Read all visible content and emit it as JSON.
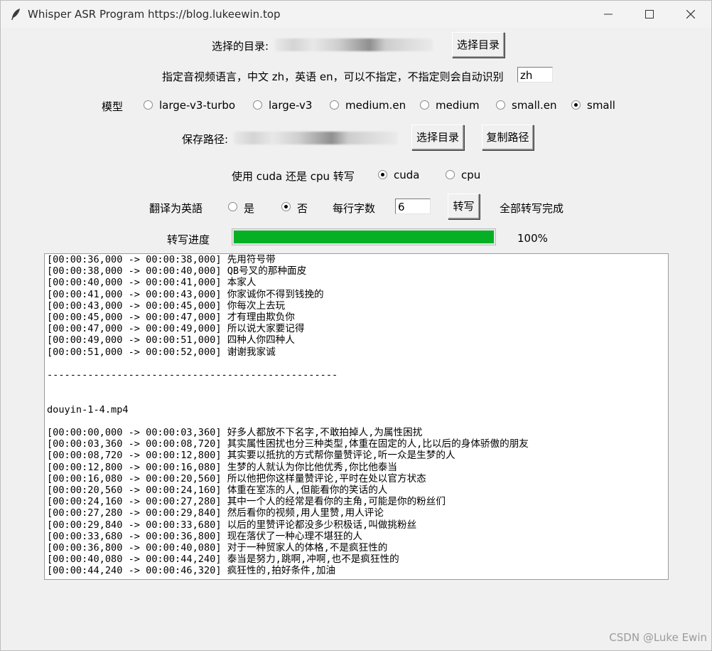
{
  "window": {
    "title": "Whisper ASR Program https://blog.lukeewin.top",
    "controls": [
      "minimize-icon",
      "maximize-icon",
      "close-icon"
    ]
  },
  "dir_row": {
    "label": "选择的目录:",
    "button": "选择目录"
  },
  "lang_row": {
    "label": "指定音视频语言，中文 zh，英语 en，可以不指定，不指定则会自动识别",
    "value": "zh"
  },
  "model_row": {
    "label": "模型",
    "options": [
      {
        "label": "large-v3-turbo",
        "selected": false
      },
      {
        "label": "large-v3",
        "selected": false
      },
      {
        "label": "medium.en",
        "selected": false
      },
      {
        "label": "medium",
        "selected": false
      },
      {
        "label": "small.en",
        "selected": false
      },
      {
        "label": "small",
        "selected": true
      }
    ]
  },
  "save_row": {
    "label": "保存路径:",
    "choose_button": "选择目录",
    "copy_button": "复制路径"
  },
  "device_row": {
    "label": "使用 cuda 还是 cpu 转写",
    "options": [
      {
        "label": "cuda",
        "selected": true
      },
      {
        "label": "cpu",
        "selected": false
      }
    ]
  },
  "translate_row": {
    "label": "翻译为英語",
    "options": [
      {
        "label": "是",
        "selected": false
      },
      {
        "label": "否",
        "selected": true
      }
    ],
    "chars_label": "每行字数",
    "chars_value": "6",
    "transcribe_button": "转写",
    "status": "全部转写完成"
  },
  "progress_row": {
    "label": "转写进度",
    "value": 1.0,
    "percent_text": "100%",
    "fill_color": "#06b025"
  },
  "output": {
    "lines": [
      "[00:00:36,000 -> 00:00:38,000] 先用符号带",
      "[00:00:38,000 -> 00:00:40,000] QB号叉的那种面皮",
      "[00:00:40,000 -> 00:00:41,000] 本家人",
      "[00:00:41,000 -> 00:00:43,000] 你家诚你不得到钱挽的",
      "[00:00:43,000 -> 00:00:45,000] 你每次上去玩",
      "[00:00:45,000 -> 00:00:47,000] 才有理由欺负你",
      "[00:00:47,000 -> 00:00:49,000] 所以说大家要记得",
      "[00:00:49,000 -> 00:00:51,000] 四种人你四种人",
      "[00:00:51,000 -> 00:00:52,000] 谢谢我家诚",
      "",
      "--------------------------------------------------",
      "",
      "",
      "douyin-1-4.mp4",
      "",
      "[00:00:00,000 -> 00:00:03,360] 好多人都放不下名字,不敢拍掉人,为属性困扰",
      "[00:00:03,360 -> 00:00:08,720] 其实属性困扰也分三种类型,体重在固定的人,比以后的身体骄傲的朋友",
      "[00:00:08,720 -> 00:00:12,800] 其实要以抵抗的方式帮你量赞评论,听一众是生梦的人",
      "[00:00:12,800 -> 00:00:16,080] 生梦的人就认为你比他优秀,你比他泰当",
      "[00:00:16,080 -> 00:00:20,560] 所以他把你这样量赞评论,平时在处以官方状态",
      "[00:00:20,560 -> 00:00:24,160] 体重在室冻的人,但能看你的笑话的人",
      "[00:00:24,160 -> 00:00:27,280] 其中一个人的经常是看你的主角,可能是你的粉丝们",
      "[00:00:27,280 -> 00:00:29,840] 然后看你的视频,用人里赞,用人评论",
      "[00:00:29,840 -> 00:00:33,680] 以后的里赞评论都没多少积极话,叫做挑粉丝",
      "[00:00:33,680 -> 00:00:36,800] 现在落伏了一种心理不堪狂的人",
      "[00:00:36,800 -> 00:00:40,080] 对于一种贸家人的体格,不是疯狂性的",
      "[00:00:40,080 -> 00:00:44,240] 泰当是努力,跳啊,冲啊,也不是疯狂性的",
      "[00:00:44,240 -> 00:00:46,320] 疯狂性的,拍好条件,加油"
    ]
  },
  "watermark": "CSDN @Luke Ewin"
}
